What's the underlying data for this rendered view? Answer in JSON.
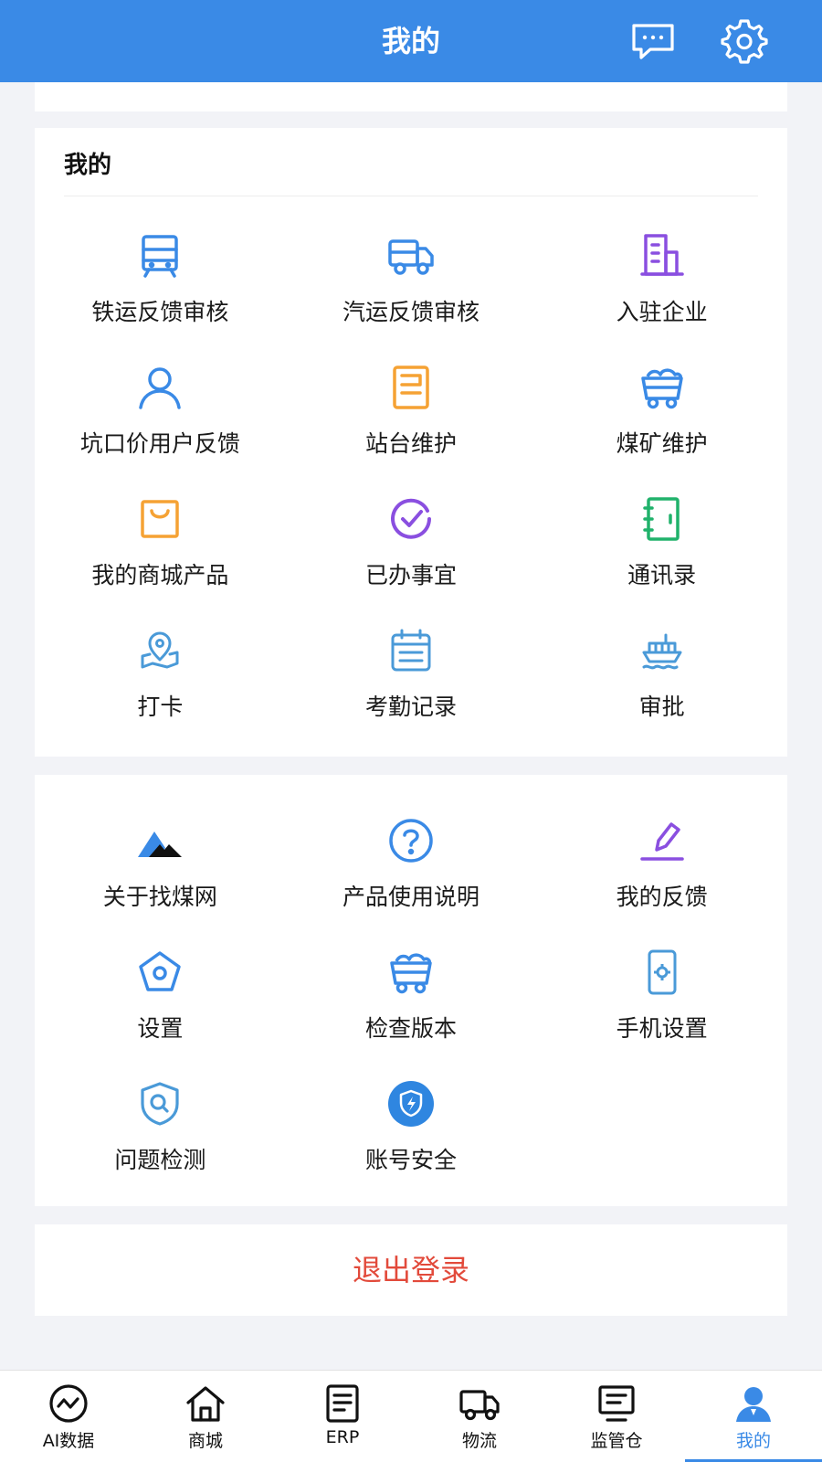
{
  "header": {
    "title": "我的",
    "message_icon": "chat-bubble-icon",
    "settings_icon": "gear-icon",
    "color": "#3a8ae6"
  },
  "mine_section": {
    "title": "我的",
    "items": [
      {
        "label": "铁运反馈审核",
        "icon": "train-icon",
        "color": "#3a8ae6"
      },
      {
        "label": "汽运反馈审核",
        "icon": "truck-icon",
        "color": "#3a8ae6"
      },
      {
        "label": "入驻企业",
        "icon": "building-icon",
        "color": "#8a4fe0"
      },
      {
        "label": "坑口价用户反馈",
        "icon": "user-icon",
        "color": "#3a8ae6"
      },
      {
        "label": "站台维护",
        "icon": "document-icon",
        "color": "#f5a234"
      },
      {
        "label": "煤矿维护",
        "icon": "mine-cart-icon",
        "color": "#3a8ae6"
      },
      {
        "label": "我的商城产品",
        "icon": "shopping-bag-icon",
        "color": "#f5a234"
      },
      {
        "label": "已办事宜",
        "icon": "check-circle-icon",
        "color": "#8a4fe0"
      },
      {
        "label": "通讯录",
        "icon": "contacts-book-icon",
        "color": "#20b26b"
      },
      {
        "label": "打卡",
        "icon": "map-pin-icon",
        "color": "#4a9ad8"
      },
      {
        "label": "考勤记录",
        "icon": "calendar-icon",
        "color": "#4a9ad8"
      },
      {
        "label": "审批",
        "icon": "ship-icon",
        "color": "#4a9ad8"
      }
    ]
  },
  "more_section": {
    "items": [
      {
        "label": "关于找煤网",
        "icon": "mountain-logo-icon",
        "color": "#3a8ae6"
      },
      {
        "label": "产品使用说明",
        "icon": "question-circle-icon",
        "color": "#3a8ae6"
      },
      {
        "label": "我的反馈",
        "icon": "pencil-icon",
        "color": "#8a4fe0"
      },
      {
        "label": "设置",
        "icon": "pentagon-settings-icon",
        "color": "#3a8ae6"
      },
      {
        "label": "检查版本",
        "icon": "mine-cart-icon",
        "color": "#3a8ae6"
      },
      {
        "label": "手机设置",
        "icon": "phone-settings-icon",
        "color": "#4a9ad8"
      },
      {
        "label": "问题检测",
        "icon": "shield-search-icon",
        "color": "#4a9ad8"
      },
      {
        "label": "账号安全",
        "icon": "shield-lightning-icon",
        "color": "#3a8ae6"
      }
    ]
  },
  "logout": {
    "label": "退出登录",
    "color": "#e24a3b"
  },
  "bottom_nav": {
    "items": [
      {
        "label": "AI数据",
        "icon": "chart-circle-icon",
        "active": false
      },
      {
        "label": "商城",
        "icon": "home-icon",
        "active": false
      },
      {
        "label": "ERP",
        "icon": "document-lines-icon",
        "active": false
      },
      {
        "label": "物流",
        "icon": "truck-icon",
        "active": false
      },
      {
        "label": "监管仓",
        "icon": "monitor-icon",
        "active": false
      },
      {
        "label": "我的",
        "icon": "person-icon",
        "active": true
      }
    ],
    "active_color": "#3a8ae6"
  }
}
